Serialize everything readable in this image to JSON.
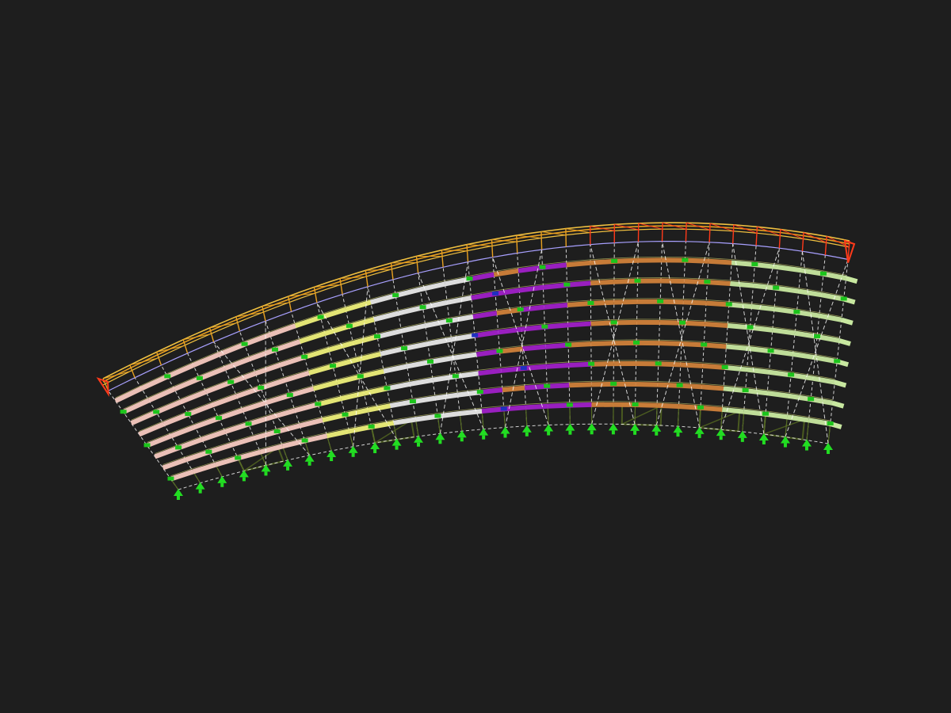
{
  "view": {
    "background": "#1e1e1e"
  },
  "structure": {
    "type": "curved multi-storey frame model (3D wireframe)",
    "floor_count": 8,
    "bay_count": 30,
    "support_count": 31,
    "has_roof_truss": true,
    "has_diagonal_bracing": true
  },
  "colors": {
    "roof_truss": "#e8a020",
    "roof_truss_edge": "#ff3a1a",
    "roof_chord": "#f0c040",
    "column": "#ffffff",
    "column_dashed": "#f2f2f2",
    "slab_pink": "#f6c9c0",
    "slab_yellow": "#eef07a",
    "slab_white": "#e8e8e8",
    "slab_purple": "#a020c8",
    "slab_brown": "#d0803a",
    "slab_green": "#c8e8a0",
    "support": "#22dd22",
    "node": "#1cc41c",
    "node_blue": "#2030c0",
    "foundation": "#4a5a20",
    "edge_lavender": "#a8a0ff"
  }
}
